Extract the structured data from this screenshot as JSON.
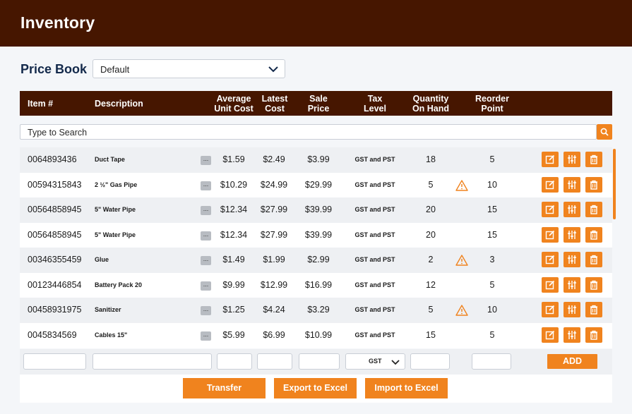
{
  "app": {
    "title": "Inventory"
  },
  "price_book": {
    "label": "Price Book",
    "selected": "Default"
  },
  "table": {
    "headers": {
      "item": "Item #",
      "description": "Description",
      "avg_cost_1": "Average",
      "avg_cost_2": "Unit Cost",
      "latest_cost_1": "Latest",
      "latest_cost_2": "Cost",
      "sale_price_1": "Sale",
      "sale_price_2": "Price",
      "tax_level_1": "Tax",
      "tax_level_2": "Level",
      "qty_1": "Quantity",
      "qty_2": "On Hand",
      "reorder_1": "Reorder",
      "reorder_2": "Point"
    },
    "search_placeholder": "Type to Search",
    "more_label": "...",
    "rows": [
      {
        "item": "0064893436",
        "description": "Duct Tape",
        "avg_cost": "$1.59",
        "latest_cost": "$2.49",
        "sale_price": "$3.99",
        "tax": "GST and PST",
        "qty": "18",
        "low_stock": false,
        "reorder": "5"
      },
      {
        "item": "00594315843",
        "description": "2 ½\" Gas Pipe",
        "avg_cost": "$10.29",
        "latest_cost": "$24.99",
        "sale_price": "$29.99",
        "tax": "GST and PST",
        "qty": "5",
        "low_stock": true,
        "reorder": "10"
      },
      {
        "item": "00564858945",
        "description": "5\" Water Pipe",
        "avg_cost": "$12.34",
        "latest_cost": "$27.99",
        "sale_price": "$39.99",
        "tax": "GST and PST",
        "qty": "20",
        "low_stock": false,
        "reorder": "15"
      },
      {
        "item": "00564858945",
        "description": "5\" Water Pipe",
        "avg_cost": "$12.34",
        "latest_cost": "$27.99",
        "sale_price": "$39.99",
        "tax": "GST and PST",
        "qty": "20",
        "low_stock": false,
        "reorder": "15"
      },
      {
        "item": "00346355459",
        "description": "Glue",
        "avg_cost": "$1.49",
        "latest_cost": "$1.99",
        "sale_price": "$2.99",
        "tax": "GST and PST",
        "qty": "2",
        "low_stock": true,
        "reorder": "3"
      },
      {
        "item": "00123446854",
        "description": "Battery Pack 20",
        "avg_cost": "$9.99",
        "latest_cost": "$12.99",
        "sale_price": "$16.99",
        "tax": "GST and PST",
        "qty": "12",
        "low_stock": false,
        "reorder": "5"
      },
      {
        "item": "00458931975",
        "description": "Sanitizer",
        "avg_cost": "$1.25",
        "latest_cost": "$4.24",
        "sale_price": "$3.29",
        "tax": "GST and PST",
        "qty": "5",
        "low_stock": true,
        "reorder": "10"
      },
      {
        "item": "0045834569",
        "description": "Cables 15\"",
        "avg_cost": "$5.99",
        "latest_cost": "$6.99",
        "sale_price": "$10.99",
        "tax": "GST and PST",
        "qty": "15",
        "low_stock": false,
        "reorder": "5"
      }
    ]
  },
  "add_row": {
    "tax_selected": "GST",
    "add_label": "ADD"
  },
  "actions": {
    "transfer": "Transfer",
    "export": "Export to Excel",
    "import": "Import to Excel"
  },
  "colors": {
    "header_bg": "#461600",
    "accent": "#f0831e",
    "title_text": "#13294b",
    "row_alt": "#eef0f3"
  },
  "icons": {
    "search": "search-icon",
    "edit": "edit-icon",
    "adjust": "sliders-icon",
    "delete": "trash-icon",
    "warning": "warning-icon",
    "dropdown": "chevron-down-icon"
  }
}
